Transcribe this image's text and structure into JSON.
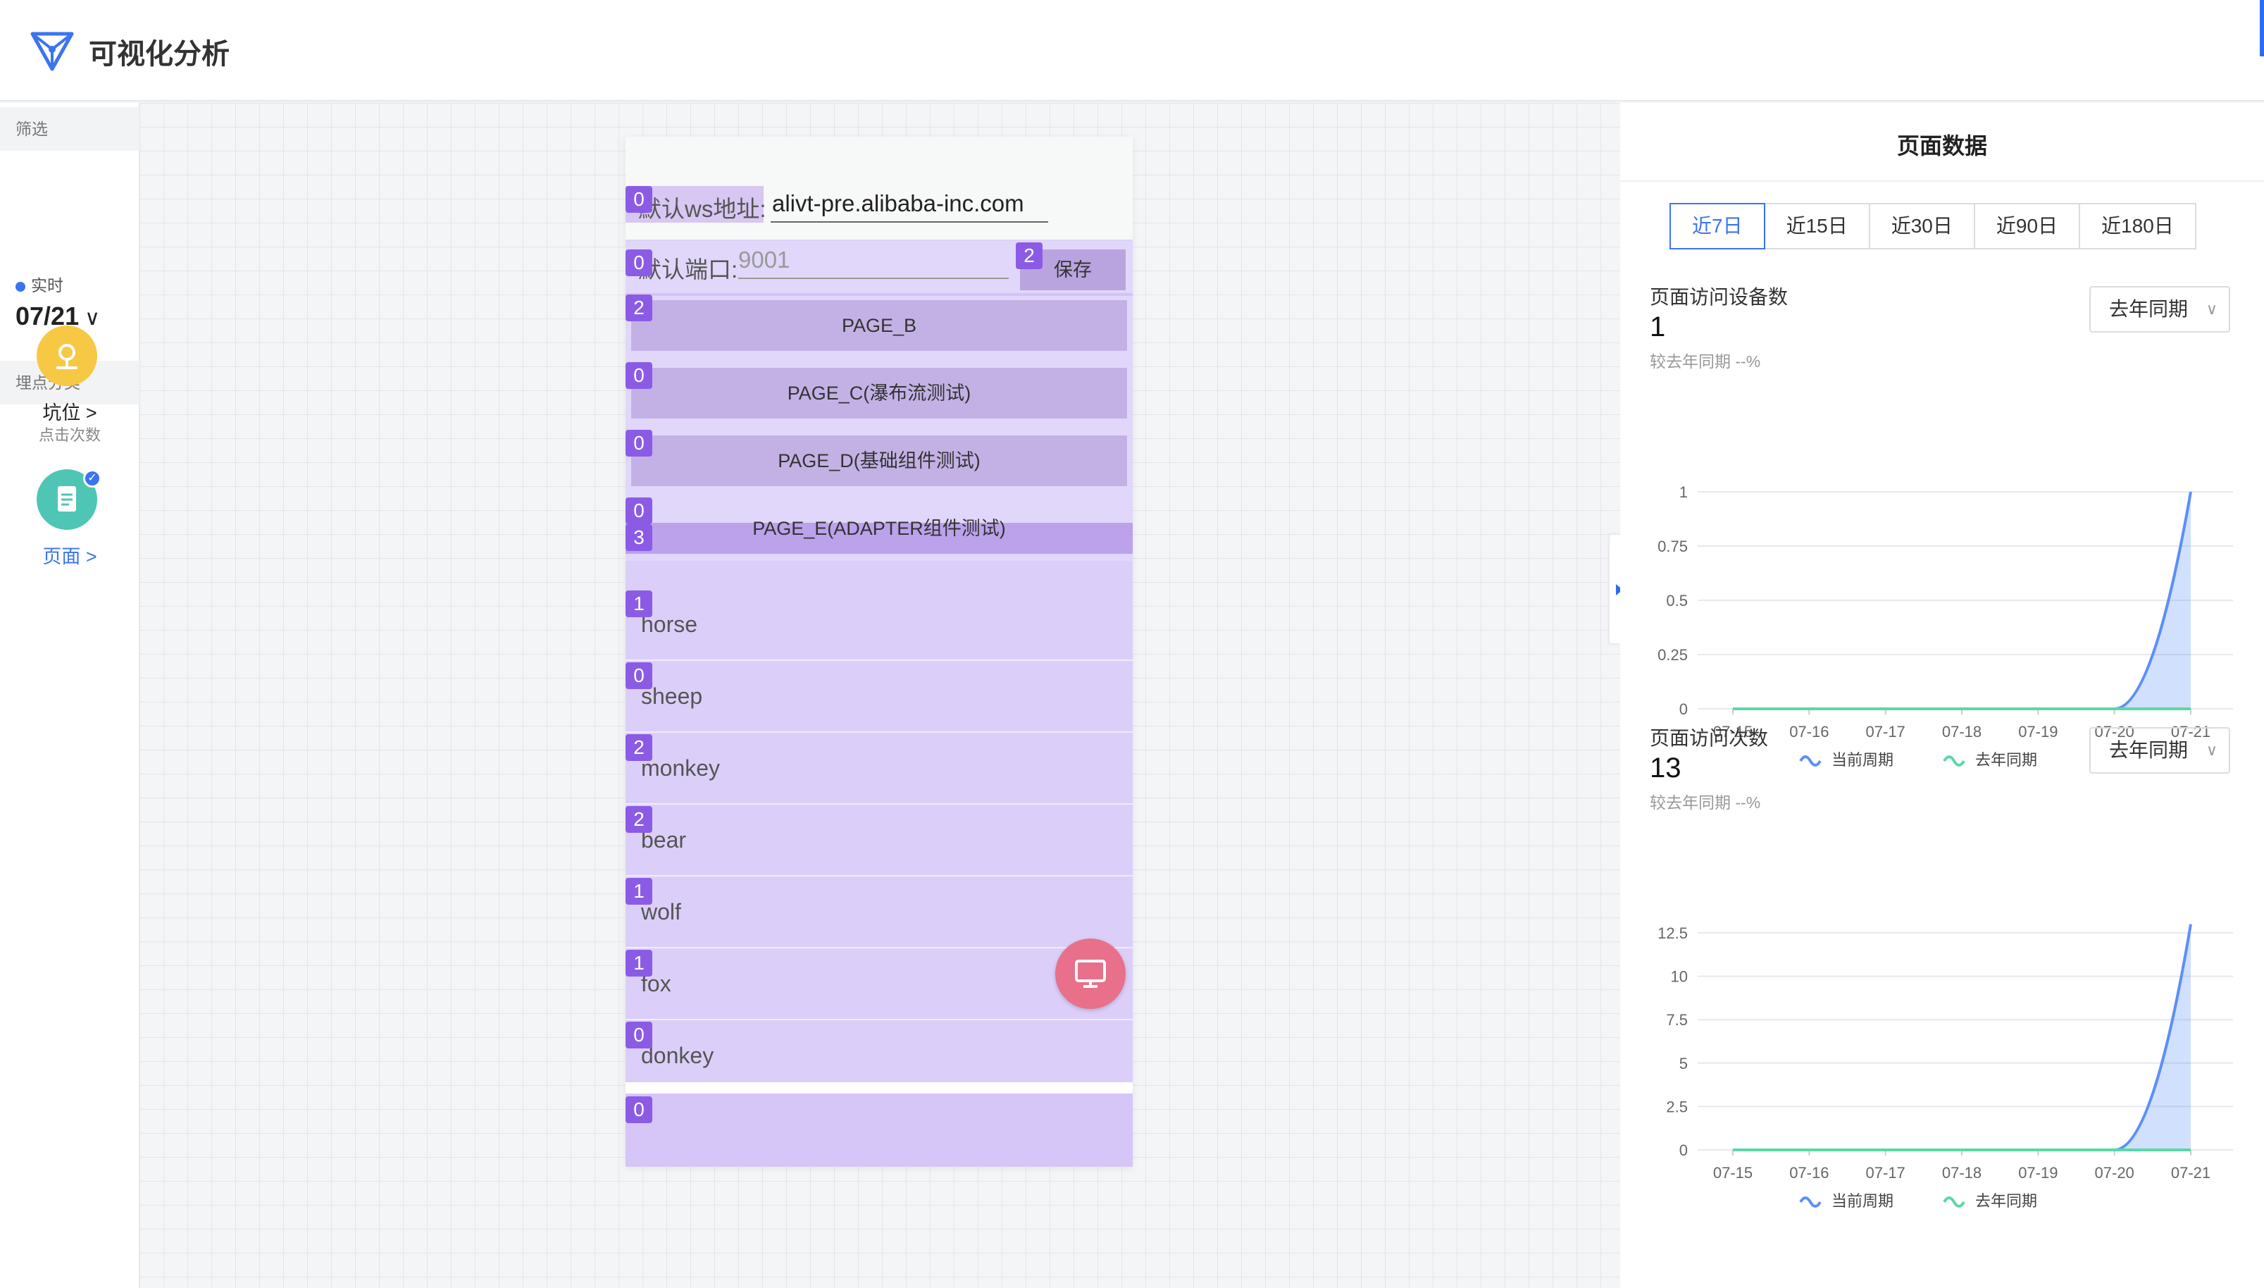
{
  "app": {
    "title": "可视化分析"
  },
  "sidebar": {
    "filter_label": "筛选",
    "realtime_label": "实时",
    "date": "07/21",
    "category_label": "埋点分类",
    "categories": [
      {
        "name": "坑位 >",
        "sub": "点击次数",
        "color": "#f7c844"
      },
      {
        "name": "页面 >",
        "sub": "",
        "color": "#4fc5b5",
        "selected": true
      }
    ]
  },
  "phone": {
    "ws_label": "默认ws地址:",
    "ws_value": "alivt-pre.alibaba-inc.com",
    "port_label": "默认端口:",
    "port_placeholder": "9001",
    "save_label": "保存",
    "ws_badge": "0",
    "port_badge": "0",
    "save_badge": "2",
    "pages": [
      {
        "label": "PAGE_B",
        "badge": "2"
      },
      {
        "label": "PAGE_C(瀑布流测试)",
        "badge": "0"
      },
      {
        "label": "PAGE_D(基础组件测试)",
        "badge": "0"
      },
      {
        "label": "PAGE_E(ADAPTER组件测试)",
        "badge": "0",
        "badge2": "3"
      }
    ],
    "list": [
      {
        "text": "horse",
        "badge": "1"
      },
      {
        "text": "sheep",
        "badge": "0"
      },
      {
        "text": "monkey",
        "badge": "2"
      },
      {
        "text": "bear",
        "badge": "2"
      },
      {
        "text": "wolf",
        "badge": "1"
      },
      {
        "text": "fox",
        "badge": "1"
      },
      {
        "text": "donkey",
        "badge": "0"
      }
    ],
    "bottom_badge": "0"
  },
  "panel": {
    "title": "页面数据",
    "tabs": [
      "近7日",
      "近15日",
      "近30日",
      "近90日",
      "近180日"
    ],
    "active_tab": 0,
    "metrics": [
      {
        "label": "页面访问设备数",
        "value": "1",
        "compare": "较去年同期 --%",
        "dropdown": "去年同期"
      },
      {
        "label": "页面访问次数",
        "value": "13",
        "compare": "较去年同期 --%",
        "dropdown": "去年同期"
      }
    ]
  },
  "chart_data": [
    {
      "type": "area",
      "title": "页面访问设备数",
      "categories": [
        "07-15",
        "07-16",
        "07-17",
        "07-18",
        "07-19",
        "07-20",
        "07-21"
      ],
      "yticks": [
        "1",
        "0.75",
        "0.5",
        "0.25",
        "0"
      ],
      "ylim": [
        0,
        1
      ],
      "series": [
        {
          "name": "当前周期",
          "values": [
            0,
            0,
            0,
            0,
            0,
            0,
            1
          ],
          "color": "#5b8ff9"
        },
        {
          "name": "去年同期",
          "values": [
            0,
            0,
            0,
            0,
            0,
            0,
            0
          ],
          "color": "#5ad8a6"
        }
      ]
    },
    {
      "type": "area",
      "title": "页面访问次数",
      "categories": [
        "07-15",
        "07-16",
        "07-17",
        "07-18",
        "07-19",
        "07-20",
        "07-21"
      ],
      "yticks": [
        "12.5",
        "10",
        "7.5",
        "5",
        "2.5",
        "0"
      ],
      "ylim": [
        0,
        12.5
      ],
      "series": [
        {
          "name": "当前周期",
          "values": [
            0,
            0,
            0,
            0,
            0,
            0,
            13
          ],
          "color": "#5b8ff9"
        },
        {
          "name": "去年同期",
          "values": [
            0,
            0,
            0,
            0,
            0,
            0,
            0
          ],
          "color": "#5ad8a6"
        }
      ]
    }
  ]
}
